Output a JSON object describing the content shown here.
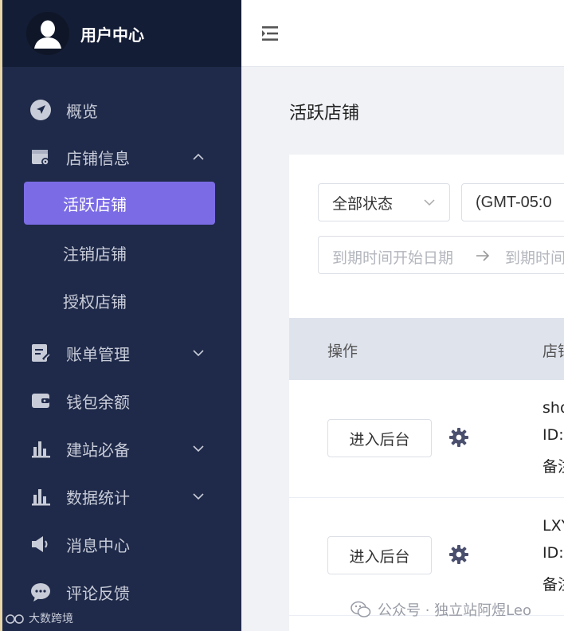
{
  "sidebar": {
    "title": "用户中心",
    "menu": [
      {
        "label": "概览",
        "icon": "navigation-icon"
      },
      {
        "label": "店铺信息",
        "icon": "store-settings-icon",
        "expanded": true
      },
      {
        "label": "账单管理",
        "icon": "bill-edit-icon"
      },
      {
        "label": "钱包余额",
        "icon": "wallet-icon"
      },
      {
        "label": "建站必备",
        "icon": "bar-chart-icon"
      },
      {
        "label": "数据统计",
        "icon": "bar-chart-icon"
      },
      {
        "label": "消息中心",
        "icon": "megaphone-icon"
      },
      {
        "label": "评论反馈",
        "icon": "chat-bubble-icon"
      }
    ],
    "store_submenu": [
      {
        "label": "活跃店铺",
        "active": true
      },
      {
        "label": "注销店铺"
      },
      {
        "label": "授权店铺"
      }
    ],
    "brand_mark": "大数跨境"
  },
  "main": {
    "title": "活跃店铺",
    "filters": {
      "status_select": "全部状态",
      "timezone_select": "(GMT-05:0",
      "date_start_placeholder": "到期时间开始日期",
      "date_end_placeholder": "到期时间"
    },
    "table": {
      "headers": [
        "操作",
        "店铺"
      ],
      "rows": [
        {
          "action": "进入后台",
          "line1": "sho",
          "line2": "ID:",
          "line3": "备注"
        },
        {
          "action": "进入后台",
          "line1": "LXY",
          "line2": "ID:",
          "line3": "备注"
        }
      ]
    }
  },
  "watermark": "公众号 · 独立站阿煜Leo",
  "colors": {
    "sidebar_bg": "#1f2a4a",
    "sidebar_header_bg": "#141d36",
    "active_item": "#7b6ce6",
    "table_header_bg": "#dfe3ec",
    "gear": "#4a4f6e"
  }
}
